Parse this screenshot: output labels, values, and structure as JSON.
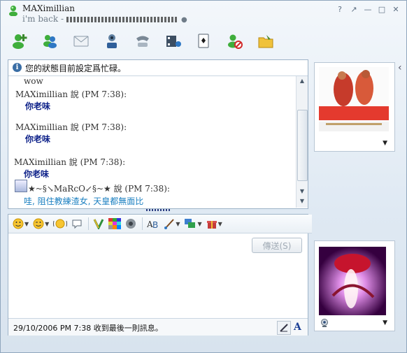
{
  "window": {
    "contact_name": "MAXimillian",
    "contact_status": "i'm back -",
    "controls": [
      "?",
      "↗",
      "—",
      "□",
      "✕"
    ]
  },
  "toolbar": {
    "buttons": [
      {
        "icon": "add-contact-icon"
      },
      {
        "icon": "invite-contacts-icon"
      },
      {
        "icon": "send-files-icon"
      },
      {
        "icon": "video-call-icon"
      },
      {
        "icon": "voice-call-icon"
      },
      {
        "icon": "share-media-icon"
      },
      {
        "icon": "games-icon"
      },
      {
        "icon": "block-contact-icon"
      },
      {
        "icon": "folder-icon"
      }
    ]
  },
  "info_bar": {
    "text": "您的狀態目前設定爲忙碌。"
  },
  "history": {
    "messages": [
      {
        "header": "",
        "body": "wow"
      },
      {
        "header": "MAXimillian 說 (PM 7:38):",
        "body": "你老味"
      },
      {
        "header": "MAXimillian 說 (PM 7:38):",
        "body": "你老味"
      },
      {
        "header": "MAXimillian 說 (PM 7:38):",
        "body": "你老味"
      },
      {
        "header": "★~§↘MaRcO↙§~★ 說 (PM 7:38):",
        "body": "哇, 阻住教練渣女, 天皇都無面比"
      }
    ]
  },
  "compose": {
    "send_label": "傳送(S)"
  },
  "status_bar": {
    "text": "29/10/2006 PM 7:38 收到最後一則訊息。",
    "font_button": "A"
  },
  "colors": {
    "message_text": "#0b1f88",
    "own_message_text": "#1a7fc0",
    "window_bg": "#dfe8f1"
  }
}
